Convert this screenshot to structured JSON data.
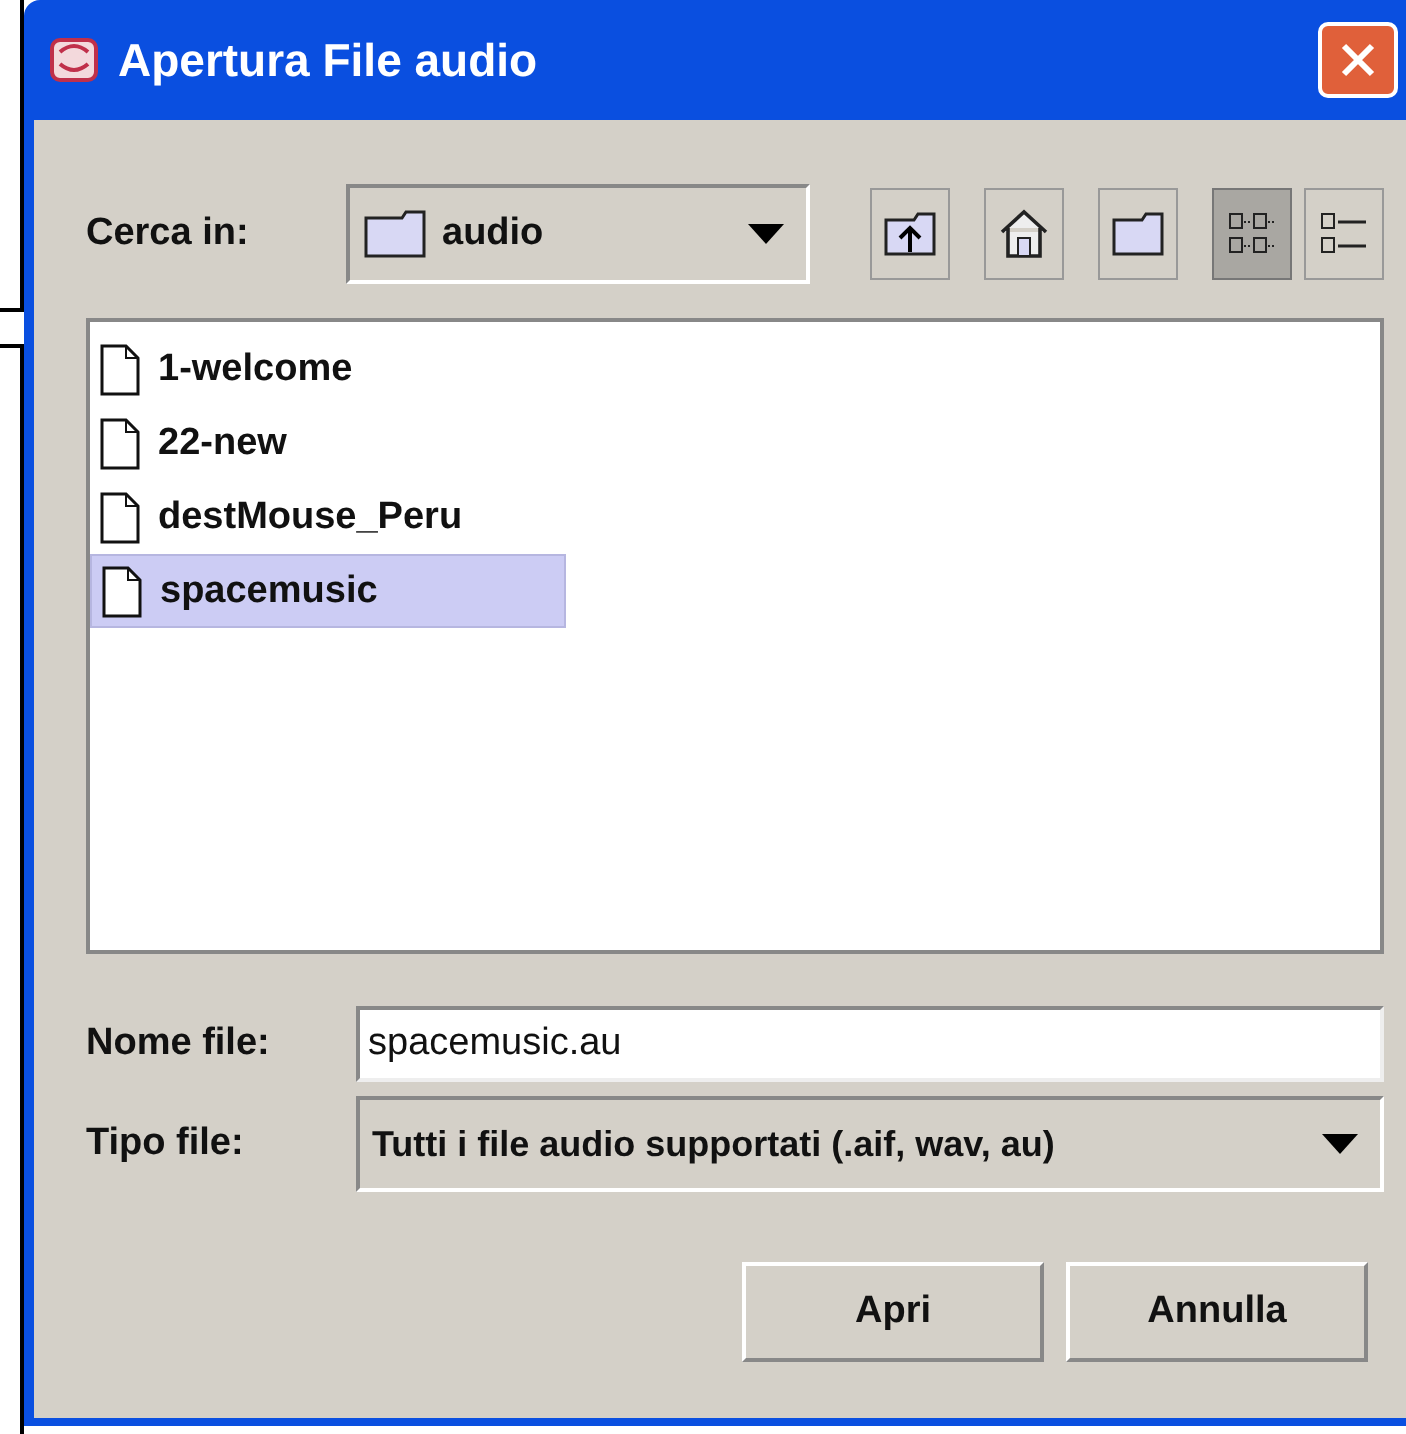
{
  "window": {
    "title": "Apertura File audio"
  },
  "look_in": {
    "label": "Cerca in:",
    "value": "audio"
  },
  "toolbar": [
    {
      "kind": "up",
      "selected": false
    },
    {
      "kind": "home",
      "selected": false
    },
    {
      "kind": "new-folder",
      "selected": false
    },
    {
      "kind": "list",
      "selected": true
    },
    {
      "kind": "details",
      "selected": false
    }
  ],
  "files": [
    {
      "name": "1-welcome",
      "selected": false
    },
    {
      "name": "22-new",
      "selected": false
    },
    {
      "name": "destMouse_Peru",
      "selected": false
    },
    {
      "name": "spacemusic",
      "selected": true
    }
  ],
  "file_name": {
    "label": "Nome file:",
    "value": "spacemusic.au"
  },
  "file_type": {
    "label": "Tipo file:",
    "value": "Tutti i file audio supportati (.aif, wav, au)"
  },
  "buttons": [
    {
      "label": "Apri"
    },
    {
      "label": "Annulla"
    }
  ]
}
